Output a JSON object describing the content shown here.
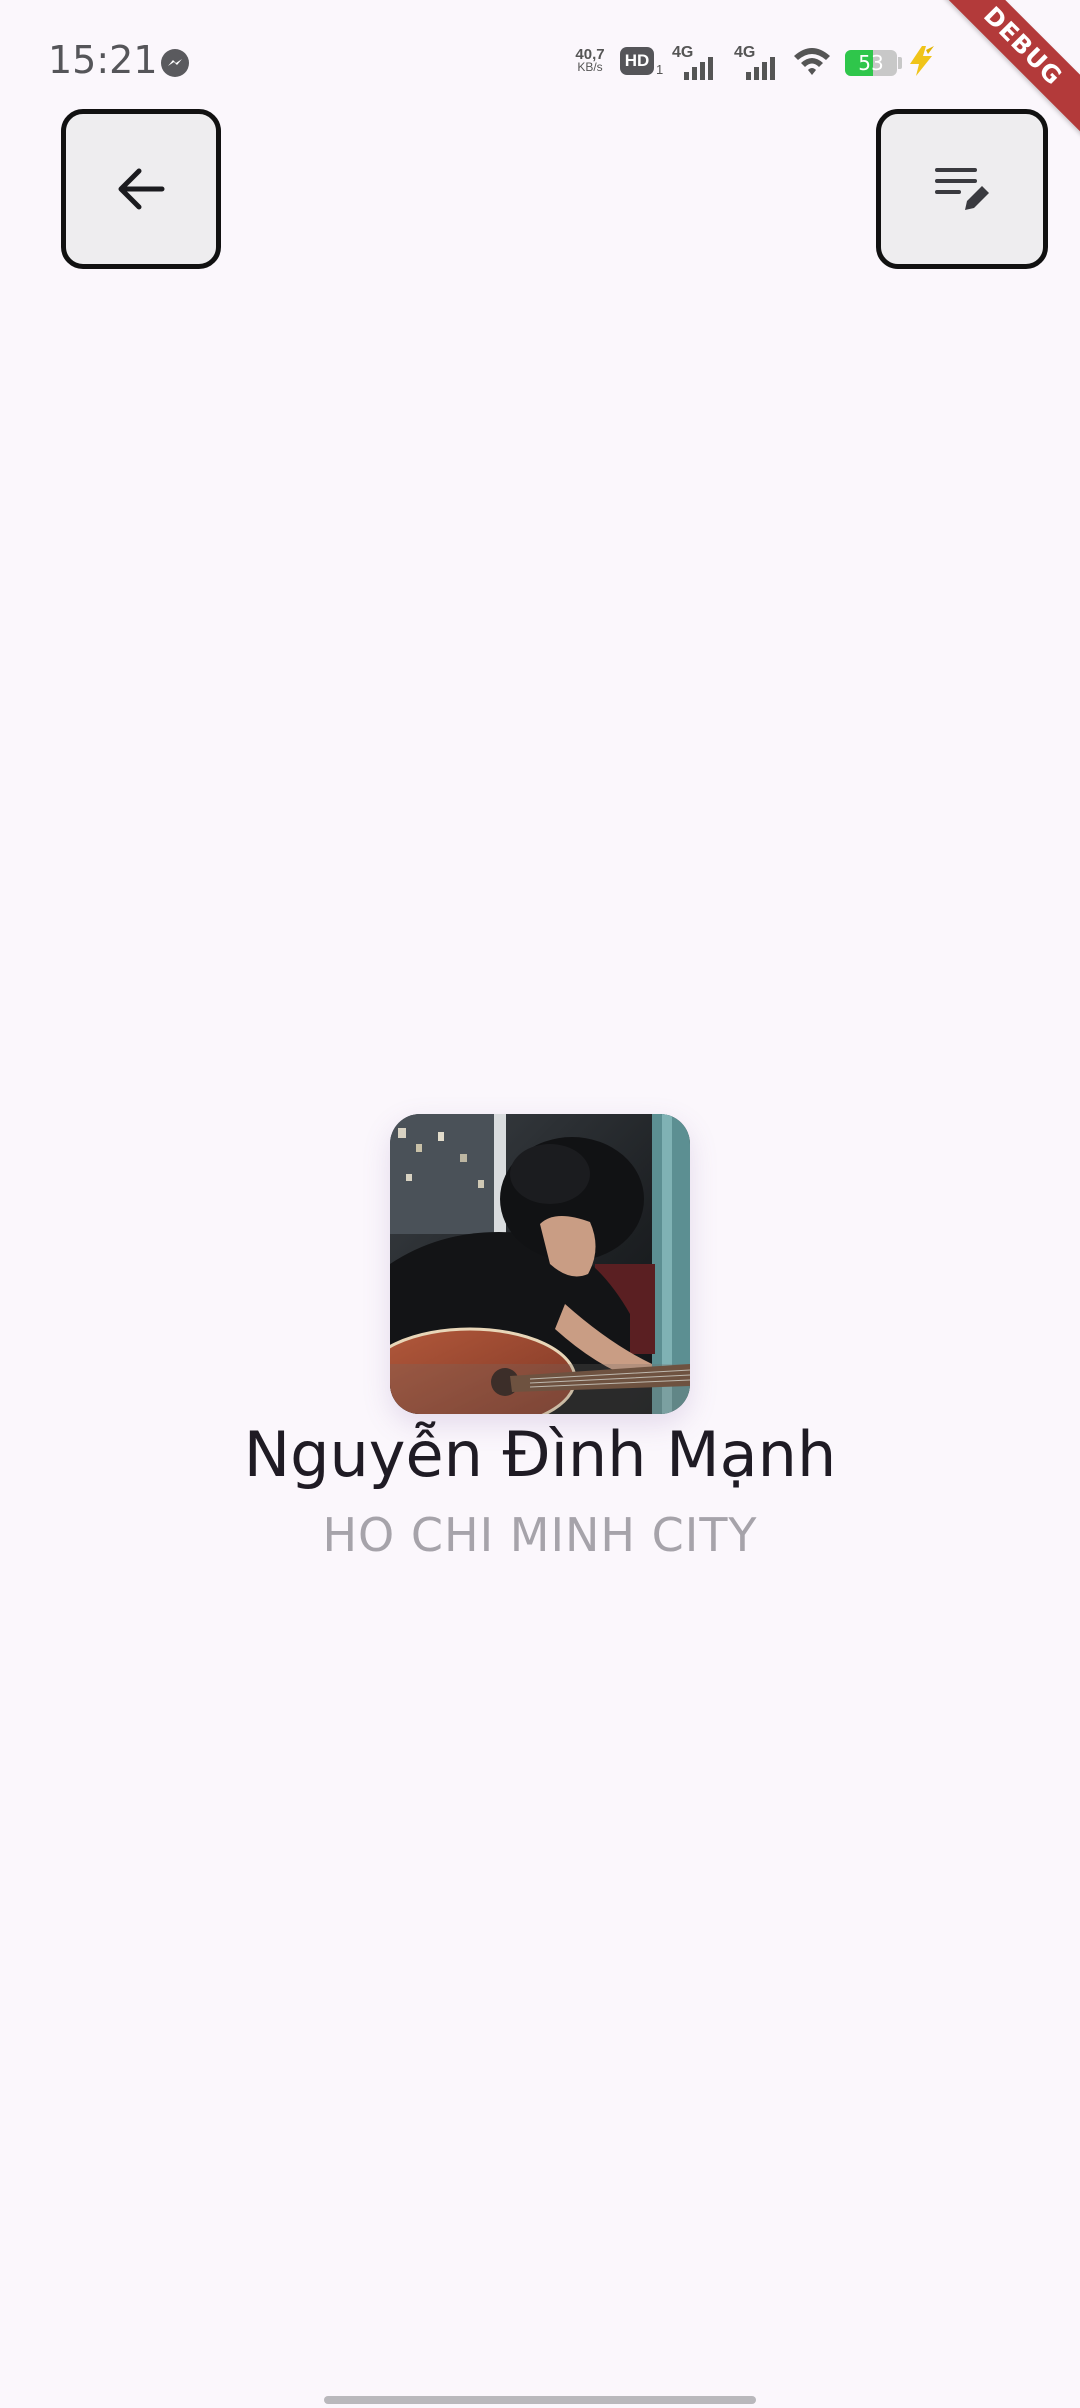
{
  "status_bar": {
    "time": "15:21",
    "net_speed_value": "40,7",
    "net_speed_unit": "KB/s",
    "hd_label": "HD",
    "hd_sub": "1",
    "signal_1_label": "4G",
    "signal_2_label": "4G",
    "battery_level": "53",
    "battery_fraction": 0.53,
    "battery_color": "#2fc64b",
    "icons": [
      "messenger-icon",
      "hd-icon",
      "signal-icon",
      "wifi-icon",
      "battery-icon",
      "charging-icon"
    ]
  },
  "debug_banner": "DEBUG",
  "toolbar": {
    "back_icon": "arrow-left-icon",
    "edit_icon": "edit-notes-icon"
  },
  "profile": {
    "name": "Nguyễn Đình Mạnh",
    "location": "HO CHI MINH CITY"
  },
  "colors": {
    "background": "#fbf7fc",
    "name_text": "#1f1b24",
    "location_text": "#a6a3aa",
    "button_border": "#111111",
    "button_fill": "#eeedef",
    "debug_banner": "#b33a3a"
  }
}
